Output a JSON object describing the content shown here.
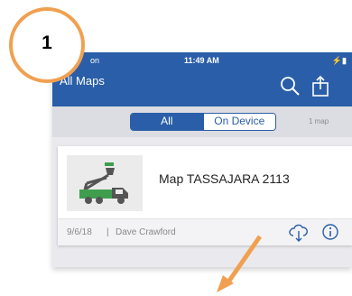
{
  "status_bar": {
    "carrier": "on",
    "time": "11:49 AM",
    "battery": "⚡▮"
  },
  "nav": {
    "back_label": "All Maps",
    "icons": [
      "search-icon",
      "share-icon"
    ]
  },
  "segments": {
    "options": [
      "All",
      "On Device"
    ],
    "selected": "All",
    "count_label": "1 map"
  },
  "map_card": {
    "name": "Map TASSAJARA 2113",
    "date": "9/6/18",
    "separator": "|",
    "author": "Dave Crawford",
    "thumbnail_icon": "bucket-truck-icon",
    "actions": [
      "cloud-download-icon",
      "info-icon"
    ]
  },
  "callout": {
    "number": "1",
    "color": "#f0a050"
  },
  "colors": {
    "nav_bar": "#2a5ea8",
    "accent": "#f0a050",
    "truck_green": "#3f9e4e"
  }
}
